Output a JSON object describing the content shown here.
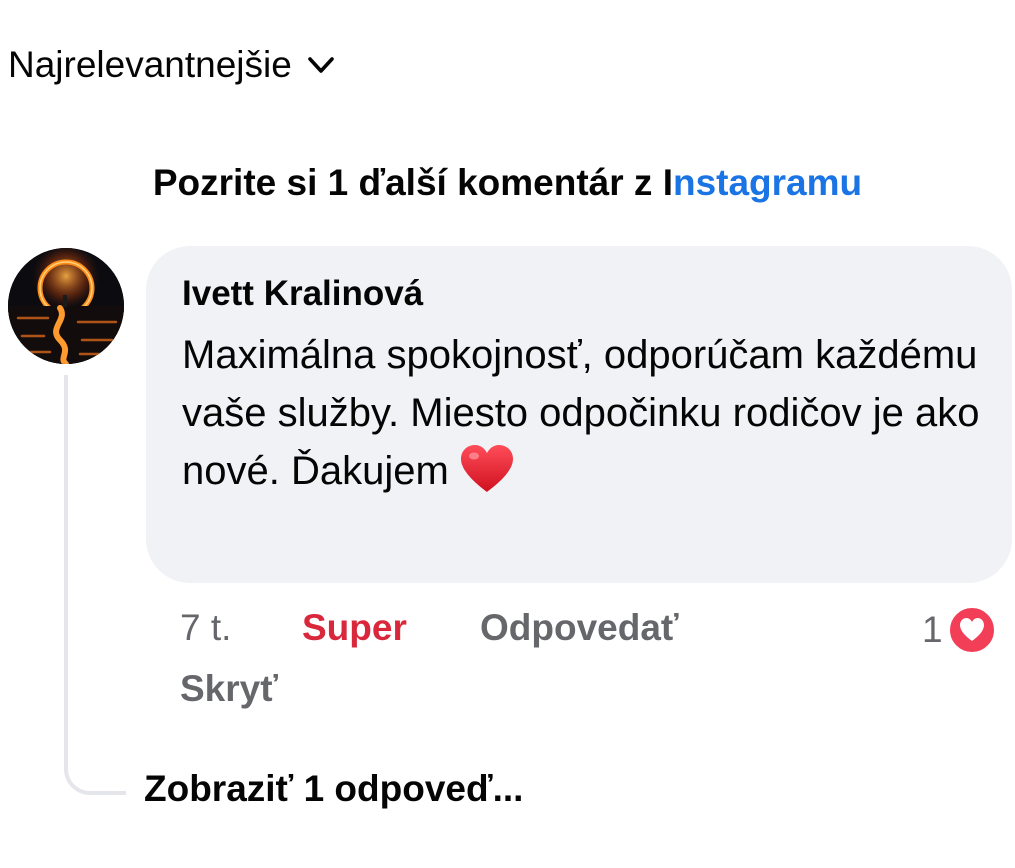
{
  "sort": {
    "label": "Najrelevantnejšie",
    "icon": "chevron-down-icon"
  },
  "instagram": {
    "lead": "Pozrite si 1 ďalší komentár z I",
    "link": "nstagramu",
    "link_color": "#1b74e4"
  },
  "comment": {
    "author": "Ivett Kralinová",
    "text": "Maximálna spokojnosť, odporúčam každému vaše služby. Miesto odpočinku rodičov je ako nové. Ďakujem",
    "emoji": "heart-icon",
    "time": "7 t.",
    "reaction_label": "Super",
    "reaction_color": "#d9283c",
    "reply_label": "Odpovedať",
    "hide_label": "Skryť",
    "reaction_count": "1",
    "reaction_icon": "love-reaction-icon"
  },
  "replies": {
    "label": "Zobraziť 1 odpoveď..."
  }
}
